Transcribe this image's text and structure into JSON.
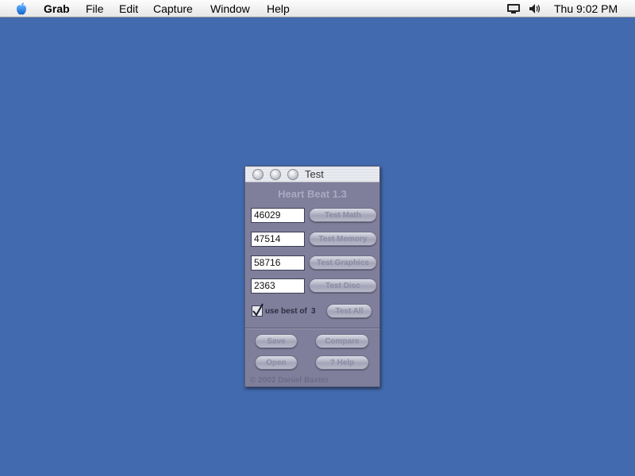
{
  "menubar": {
    "app_name": "Grab",
    "items": [
      "File",
      "Edit",
      "Capture",
      "Window",
      "Help"
    ],
    "clock": "Thu 9:02 PM",
    "icons": [
      "apple-menu-icon",
      "display-icon",
      "volume-icon"
    ]
  },
  "window": {
    "title": "Test",
    "app_heading": "Heart Beat 1.3",
    "results": [
      {
        "value": "46029",
        "button": "Test Math"
      },
      {
        "value": "47514",
        "button": "Test Memory"
      },
      {
        "value": "58716",
        "button": "Test Graphics"
      },
      {
        "value": "2363",
        "button": "Test Disc"
      }
    ],
    "use_best": {
      "label": "use best of",
      "count": "3",
      "checked": true
    },
    "test_all_label": "Test All",
    "save_label": "Save",
    "compare_label": "Compare",
    "open_label": "Open",
    "help_label": "? Help",
    "copyright": "© 2002 Daniel Baxter"
  },
  "colors": {
    "desktop": "#426aae",
    "window_body": "#7f7f9c",
    "heading_text": "#a9a9c2"
  }
}
